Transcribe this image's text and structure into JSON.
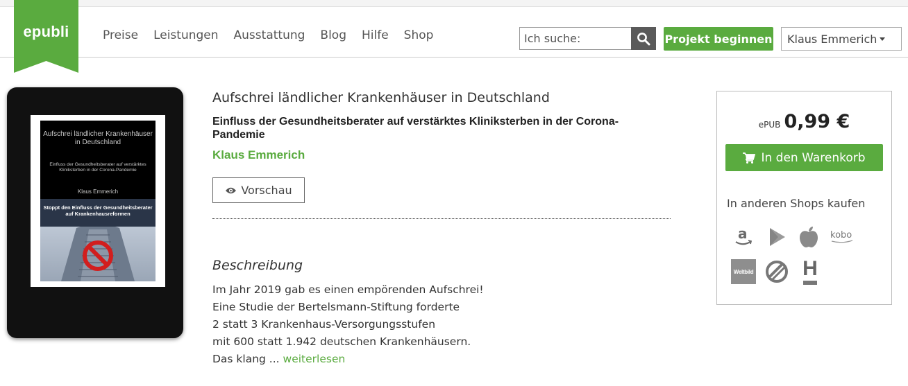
{
  "header": {
    "logo_text": "epubli",
    "nav": [
      "Preise",
      "Leistungen",
      "Ausstattung",
      "Blog",
      "Hilfe",
      "Shop"
    ],
    "search_placeholder": "Ich suche:",
    "project_button": "Projekt beginnen",
    "user_name": "Klaus Emmerich"
  },
  "cover": {
    "title": "Aufschrei ländlicher Krankenhäuser in Deutschland",
    "subtitle": "Einfluss der Gesundheitsberater auf verstärktes Kliniksterben in der Corona-Pandemie",
    "author": "Klaus Emmerich",
    "banner": "Stoppt den Einfluss der Gesundheitsberater auf Krankenhausreformen"
  },
  "product": {
    "title": "Aufschrei ländlicher Krankenhäuser in Deutschland",
    "subtitle": "Einfluss der Gesundheitsberater auf verstärktes Kliniksterben in der Corona-Pandemie",
    "author": "Klaus Emmerich",
    "preview_button": "Vorschau"
  },
  "description": {
    "heading": "Beschreibung",
    "lines": [
      "Im Jahr 2019 gab es einen empörenden Aufschrei!",
      "Eine Studie der Bertelsmann-Stiftung forderte",
      "2 statt 3 Krankenhaus-Versorgungsstufen",
      "mit 600 statt 1.942 deutschen Krankenhäusern.",
      "Das klang ..."
    ],
    "read_more": "weiterlesen"
  },
  "buybox": {
    "format": "ePUB",
    "price": "0,99 €",
    "cart_button": "In den Warenkorb",
    "other_shops_label": "In anderen Shops kaufen",
    "shops": [
      {
        "name": "amazon",
        "icon": "amazon-icon"
      },
      {
        "name": "google-play",
        "icon": "google-play-icon"
      },
      {
        "name": "apple",
        "icon": "apple-icon"
      },
      {
        "name": "kobo",
        "icon": "kobo-icon",
        "text": "kobo"
      },
      {
        "name": "weltbild",
        "icon": "weltbild-icon",
        "text": "Weltbild"
      },
      {
        "name": "ebook-de",
        "icon": "ebook-de-icon"
      },
      {
        "name": "hugendubel",
        "icon": "hugendubel-icon",
        "text": "H"
      }
    ]
  },
  "colors": {
    "brand_green": "#5aab3f",
    "search_button": "#5a5a5a"
  }
}
